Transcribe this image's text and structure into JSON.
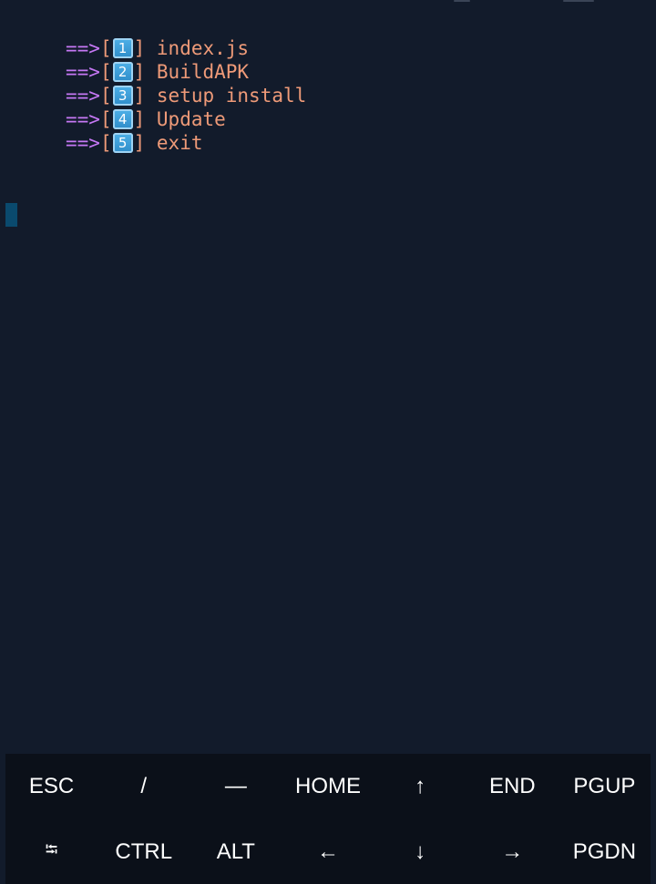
{
  "terminal": {
    "menu": [
      {
        "arrow": "==>",
        "open": "[",
        "num": "1",
        "close": "]",
        "label": "index.js"
      },
      {
        "arrow": "==>",
        "open": "[",
        "num": "2",
        "close": "]",
        "label": "BuildAPK"
      },
      {
        "arrow": "==>",
        "open": "[",
        "num": "3",
        "close": "]",
        "label": "setup install"
      },
      {
        "arrow": "==>",
        "open": "[",
        "num": "4",
        "close": "]",
        "label": "Update"
      },
      {
        "arrow": "==>",
        "open": "[",
        "num": "5",
        "close": "]",
        "label": "exit"
      }
    ]
  },
  "extra_keys": {
    "row1": [
      "ESC",
      "/",
      "—",
      "HOME",
      "↑",
      "END",
      "PGUP"
    ],
    "row2": [
      "⭾",
      "CTRL",
      "ALT",
      "←",
      "↓",
      "→",
      "PGDN"
    ]
  },
  "colors": {
    "background": "#121b2b",
    "arrow": "#c678f5",
    "text": "#ee9a78",
    "cursor": "#0a4a6e",
    "keys_bar": "#0b1019"
  }
}
